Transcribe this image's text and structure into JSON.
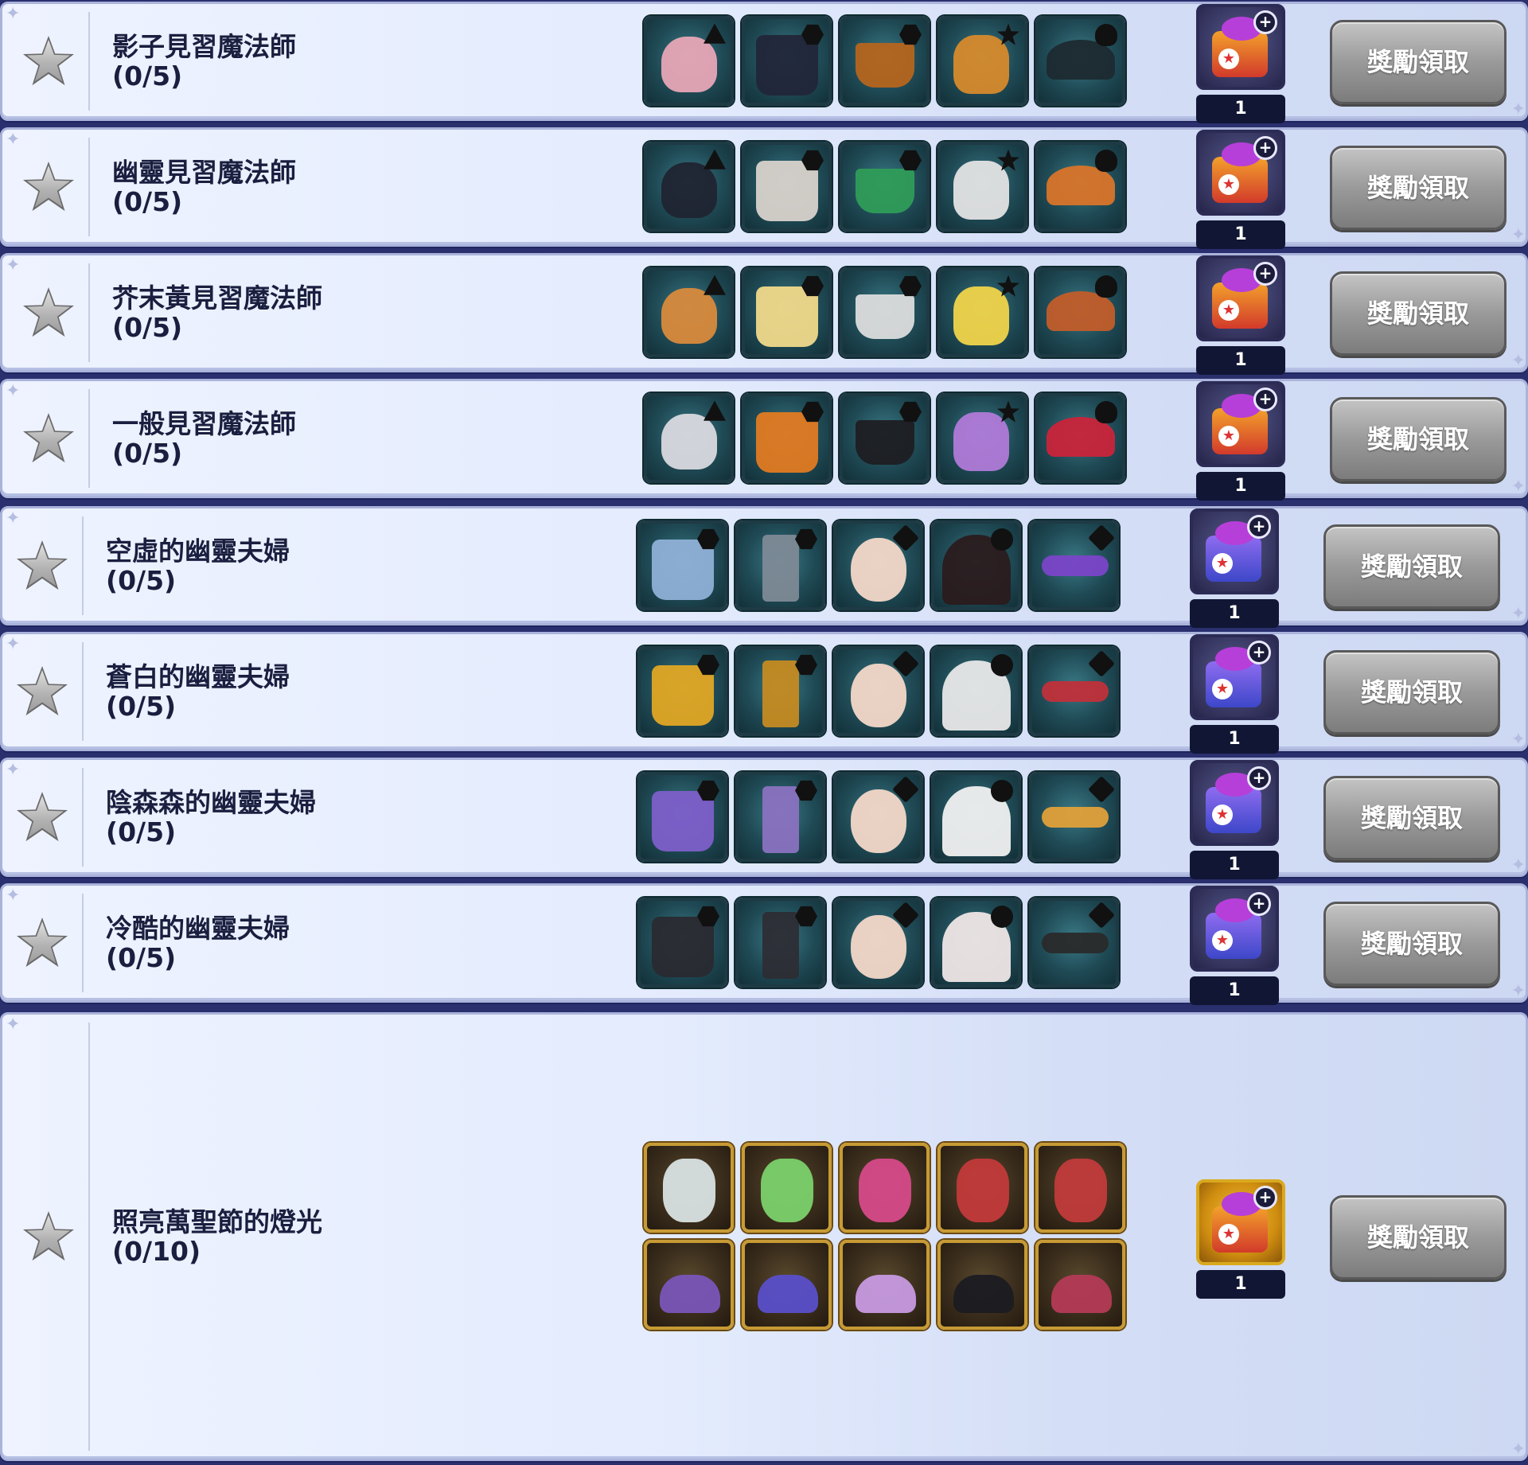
{
  "claim_label": "獎勵領取",
  "missions": [
    {
      "name": "影子見習魔法師",
      "progress": "(0/5)",
      "reward_qty": "1",
      "chest": "gold-red-chest",
      "items": [
        [
          "hair",
          "#e7a7b6",
          "tri"
        ],
        [
          "clothes",
          "#22263a",
          "hex"
        ],
        [
          "bottom",
          "#b5651d",
          "hex"
        ],
        [
          "pet",
          "#d68a2c",
          "starshape"
        ],
        [
          "hat",
          "#1e2a30",
          "club"
        ]
      ]
    },
    {
      "name": "幽靈見習魔法師",
      "progress": "(0/5)",
      "reward_qty": "1",
      "chest": "gold-red-chest",
      "items": [
        [
          "hair",
          "#202431",
          "tri"
        ],
        [
          "clothes",
          "#d8d2cb",
          "hex"
        ],
        [
          "bottom",
          "#2f9c59",
          "hex"
        ],
        [
          "pet",
          "#e3e3e3",
          "starshape"
        ],
        [
          "hat",
          "#d8742a",
          "club"
        ]
      ]
    },
    {
      "name": "芥末黃見習魔法師",
      "progress": "(0/5)",
      "reward_qty": "1",
      "chest": "gold-red-chest",
      "items": [
        [
          "hair",
          "#d88a3c",
          "tri"
        ],
        [
          "clothes",
          "#f0d98a",
          "hex"
        ],
        [
          "bottom",
          "#dcdcdc",
          "hex"
        ],
        [
          "pet",
          "#f0d44a",
          "starshape"
        ],
        [
          "hat",
          "#c25d2a",
          "club"
        ]
      ]
    },
    {
      "name": "一般見習魔法師",
      "progress": "(0/5)",
      "reward_qty": "1",
      "chest": "gold-red-chest",
      "items": [
        [
          "hair",
          "#d9d9df",
          "tri"
        ],
        [
          "clothes",
          "#e07a22",
          "hex"
        ],
        [
          "bottom",
          "#1e1e22",
          "hex"
        ],
        [
          "pet",
          "#b07ad8",
          "starshape"
        ],
        [
          "hat",
          "#c9243a",
          "club"
        ]
      ]
    },
    {
      "name": "空虛的幽靈夫婦",
      "progress": "(0/5)",
      "reward_qty": "1",
      "chest": "blue-purple-chest",
      "items": [
        [
          "clothes",
          "#8fb0d6",
          "hex"
        ],
        [
          "pants",
          "#7d8a96",
          "hex"
        ],
        [
          "face",
          "#f3d8c8",
          "diamond"
        ],
        [
          "veil",
          "#2a1b1e",
          "circle"
        ],
        [
          "acc",
          "#7a44c8",
          "diamond"
        ]
      ]
    },
    {
      "name": "蒼白的幽靈夫婦",
      "progress": "(0/5)",
      "reward_qty": "1",
      "chest": "blue-purple-chest",
      "items": [
        [
          "clothes",
          "#e0a624",
          "hex"
        ],
        [
          "pants",
          "#c48b22",
          "hex"
        ],
        [
          "face",
          "#f3d8c8",
          "diamond"
        ],
        [
          "veil",
          "#e8e8e8",
          "circle"
        ],
        [
          "acc",
          "#c0303a",
          "diamond"
        ]
      ]
    },
    {
      "name": "陰森森的幽靈夫婦",
      "progress": "(0/5)",
      "reward_qty": "1",
      "chest": "blue-purple-chest",
      "items": [
        [
          "clothes",
          "#7d5fc9",
          "hex"
        ],
        [
          "pants",
          "#8a72c0",
          "hex"
        ],
        [
          "face",
          "#f3d8c8",
          "diamond"
        ],
        [
          "veil",
          "#f0f0f0",
          "circle"
        ],
        [
          "acc",
          "#e0a03a",
          "diamond"
        ]
      ]
    },
    {
      "name": "冷酷的幽靈夫婦",
      "progress": "(0/5)",
      "reward_qty": "1",
      "chest": "blue-purple-chest",
      "items": [
        [
          "clothes",
          "#2a2a30",
          "hex"
        ],
        [
          "pants",
          "#2d2d35",
          "hex"
        ],
        [
          "face",
          "#f3d8c8",
          "diamond"
        ],
        [
          "veil",
          "#efe6e6",
          "circle"
        ],
        [
          "acc",
          "#2a2a2a",
          "diamond"
        ]
      ]
    },
    {
      "name": "照亮萬聖節的燈光",
      "progress": "(0/10)",
      "reward_qty": "1",
      "chest": "gold-pumpkin-chest",
      "items": [
        [
          "lantern",
          "#d9e3e3",
          ""
        ],
        [
          "lantern",
          "#7bd16b",
          ""
        ],
        [
          "lantern",
          "#d64a8a",
          ""
        ],
        [
          "lantern",
          "#c23a3a",
          ""
        ],
        [
          "lantern",
          "#c13b3b",
          ""
        ],
        [
          "shoe",
          "#7a55b8",
          ""
        ],
        [
          "shoe",
          "#5a4fc9",
          ""
        ],
        [
          "shoe",
          "#c79ae0",
          ""
        ],
        [
          "shoe",
          "#1b1b22",
          ""
        ],
        [
          "shoe",
          "#b33a55",
          ""
        ]
      ]
    }
  ]
}
